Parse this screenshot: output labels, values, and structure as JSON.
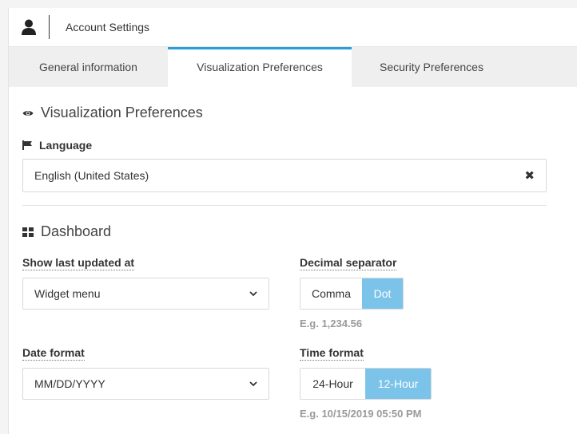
{
  "header": {
    "title": "Account Settings",
    "icon": "user-icon"
  },
  "tabs": [
    {
      "label": "General information",
      "active": false
    },
    {
      "label": "Visualization Preferences",
      "active": true
    },
    {
      "label": "Security Preferences",
      "active": false
    }
  ],
  "visualization": {
    "section_title": "Visualization Preferences",
    "icon": "eye-icon"
  },
  "language": {
    "label": "Language",
    "icon": "flag-icon",
    "value": "English (United States)",
    "clear_label": "✖"
  },
  "dashboard": {
    "section_title": "Dashboard",
    "icon": "dashboard-grid-icon",
    "last_updated": {
      "label": "Show last updated at",
      "value": "Widget menu"
    },
    "date_format": {
      "label": "Date format",
      "value": "MM/DD/YYYY"
    },
    "decimal_separator": {
      "label": "Decimal separator",
      "options": [
        "Comma",
        "Dot"
      ],
      "selected": "Dot",
      "example": "E.g. 1,234.56"
    },
    "time_format": {
      "label": "Time format",
      "options": [
        "24-Hour",
        "12-Hour"
      ],
      "selected": "12-Hour",
      "example": "E.g. 10/15/2019 05:50 PM"
    }
  },
  "colors": {
    "accent": "#2a9fd6",
    "toggle_active": "#7cc3ea"
  }
}
